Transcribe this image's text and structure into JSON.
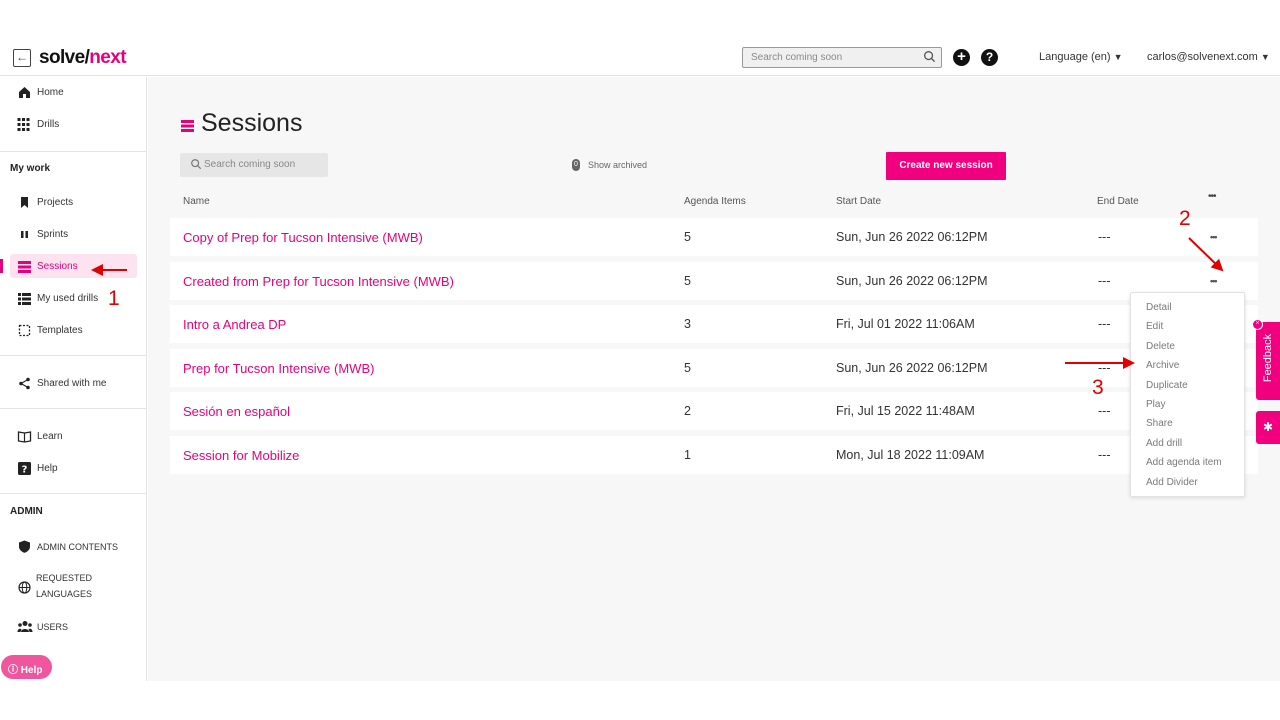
{
  "header": {
    "logo_part1": "solve/",
    "logo_part2": "next",
    "search_placeholder": "Search coming soon",
    "plus_glyph": "+",
    "help_glyph": "?",
    "language": "Language (en)",
    "user": "carlos@solvenext.com"
  },
  "sidebar": {
    "home": "Home",
    "drills": "Drills",
    "my_work_heading": "My work",
    "projects": "Projects",
    "sprints": "Sprints",
    "sessions": "Sessions",
    "my_used_drills": "My used drills",
    "templates": "Templates",
    "shared": "Shared with me",
    "learn": "Learn",
    "help": "Help",
    "admin_heading": "ADMIN",
    "admin_contents": "ADMIN CONTENTS",
    "requested_languages_1": "REQUESTED",
    "requested_languages_2": "LANGUAGES",
    "users": "USERS",
    "help_pill": "Help"
  },
  "main": {
    "title": "Sessions",
    "search_placeholder": "Search coming soon",
    "archived_count": "0",
    "show_archived": "Show archived",
    "create_button": "Create new session",
    "columns": [
      "Name",
      "Agenda Items",
      "Start Date",
      "End Date"
    ],
    "actions_header": "•••",
    "rows": [
      {
        "name": "Copy of Prep for Tucson Intensive (MWB)",
        "items": "5",
        "start": "Sun, Jun 26 2022 06:12PM",
        "end": "---",
        "dots": "•••"
      },
      {
        "name": "Created from Prep for Tucson Intensive (MWB)",
        "items": "5",
        "start": "Sun, Jun 26 2022 06:12PM",
        "end": "---",
        "dots": "•••"
      },
      {
        "name": "Intro a Andrea DP",
        "items": "3",
        "start": "Fri, Jul 01 2022 11:06AM",
        "end": "---",
        "dots": ""
      },
      {
        "name": "Prep for Tucson Intensive (MWB)",
        "items": "5",
        "start": "Sun, Jun 26 2022 06:12PM",
        "end": "---",
        "dots": ""
      },
      {
        "name": "Sesión en español",
        "items": "2",
        "start": "Fri, Jul 15 2022 11:48AM",
        "end": "---",
        "dots": ""
      },
      {
        "name": "Session for Mobilize",
        "items": "1",
        "start": "Mon, Jul 18 2022 11:09AM",
        "end": "---",
        "dots": ""
      }
    ]
  },
  "context_menu": [
    "Detail",
    "Edit",
    "Delete",
    "Archive",
    "Duplicate",
    "Play",
    "Share",
    "Add drill",
    "Add agenda item",
    "Add Divider"
  ],
  "feedback": {
    "label": "Feedback",
    "badge": "×",
    "bug_glyph": "✱"
  },
  "annotations": {
    "step1": "1",
    "step2": "2",
    "step3": "3"
  },
  "colors": {
    "accent": "#e6007e",
    "annotation": "#e00000"
  }
}
